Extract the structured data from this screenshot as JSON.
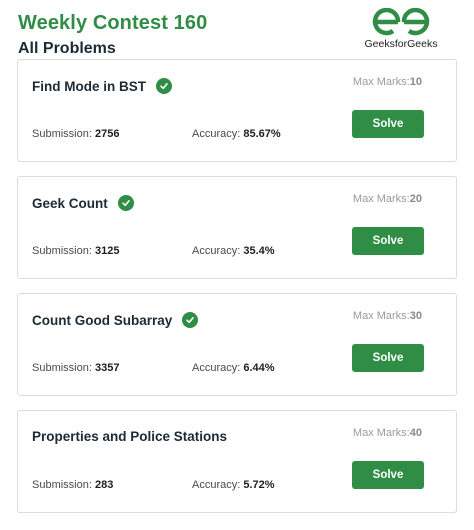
{
  "header": {
    "contest_title": "Weekly Contest 160",
    "section_title": "All Problems",
    "logo_text": "GeeksforGeeks"
  },
  "colors": {
    "brand_green": "#2f8d46",
    "muted_text": "#9a9a9a"
  },
  "problems": [
    {
      "title": "Find Mode in BST",
      "solved": true,
      "max_marks_label": "Max Marks:",
      "max_marks": "10",
      "submission_label": "Submission:",
      "submission": "2756",
      "accuracy_label": "Accuracy:",
      "accuracy": "85.67%",
      "button_label": "Solve"
    },
    {
      "title": "Geek Count",
      "solved": true,
      "max_marks_label": "Max Marks:",
      "max_marks": "20",
      "submission_label": "Submission:",
      "submission": "3125",
      "accuracy_label": "Accuracy:",
      "accuracy": "35.4%",
      "button_label": "Solve"
    },
    {
      "title": "Count Good Subarray",
      "solved": true,
      "max_marks_label": "Max Marks:",
      "max_marks": "30",
      "submission_label": "Submission:",
      "submission": "3357",
      "accuracy_label": "Accuracy:",
      "accuracy": "6.44%",
      "button_label": "Solve"
    },
    {
      "title": "Properties and Police Stations",
      "solved": false,
      "max_marks_label": "Max Marks:",
      "max_marks": "40",
      "submission_label": "Submission:",
      "submission": "283",
      "accuracy_label": "Accuracy:",
      "accuracy": "5.72%",
      "button_label": "Solve"
    }
  ]
}
